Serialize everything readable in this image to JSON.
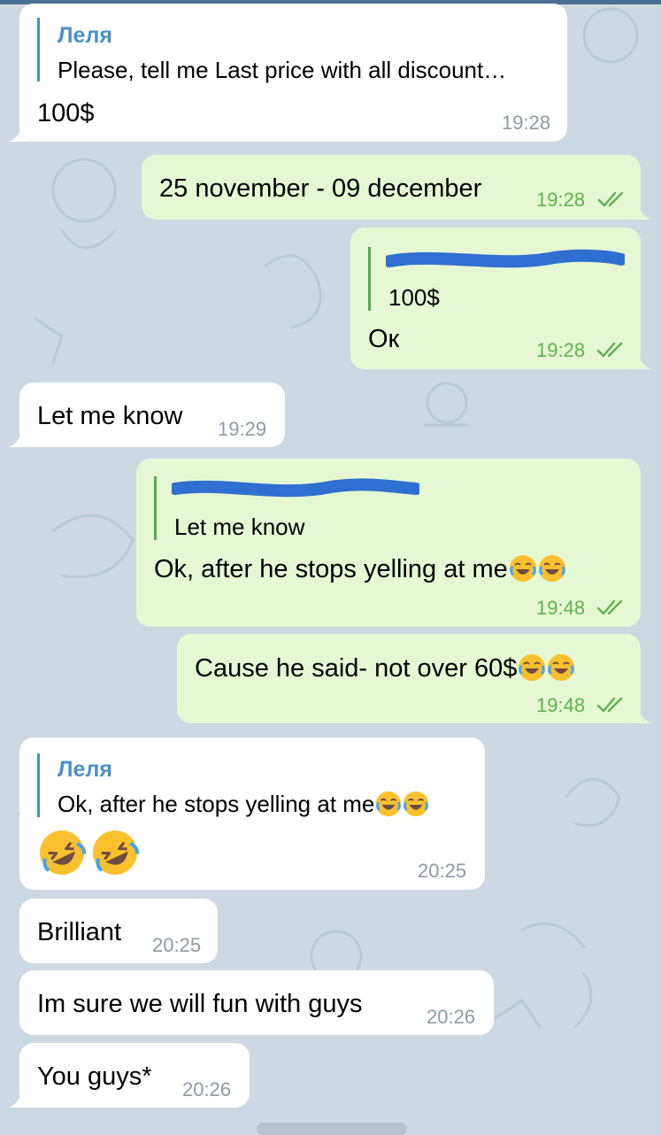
{
  "messages": [
    {
      "reply_name": "Леля",
      "reply_text": "Please, tell me Last price with all discount…",
      "text": "100$",
      "time": "19:28"
    },
    {
      "text": "25 november - 09 december",
      "time": "19:28"
    },
    {
      "reply_text": "100$",
      "text": "Ок",
      "time": "19:28"
    },
    {
      "text": "Let me know",
      "time": "19:29"
    },
    {
      "reply_text": "Let me know",
      "text": "Ok, after he stops yelling at me",
      "time": "19:48"
    },
    {
      "text": "Cause he said- not over 60$",
      "time": "19:48"
    },
    {
      "reply_name": "Леля",
      "reply_text": "Ok, after he stops yelling at me",
      "time": "20:25"
    },
    {
      "text": "Brilliant",
      "time": "20:25"
    },
    {
      "text": "Im sure we will fun with guys",
      "time": "20:26"
    },
    {
      "text": "You guys*",
      "time": "20:26"
    }
  ],
  "colors": {
    "background": "#cdd8e3",
    "incoming_bubble": "#ffffff",
    "outgoing_bubble": "#e6f8d3",
    "reply_accent_in": "#4a90c8",
    "reply_accent_out": "#4caf50",
    "redaction": "#2f6fd1"
  },
  "icons": [
    "double-check-icon",
    "joy-emoji",
    "rofl-emoji"
  ]
}
